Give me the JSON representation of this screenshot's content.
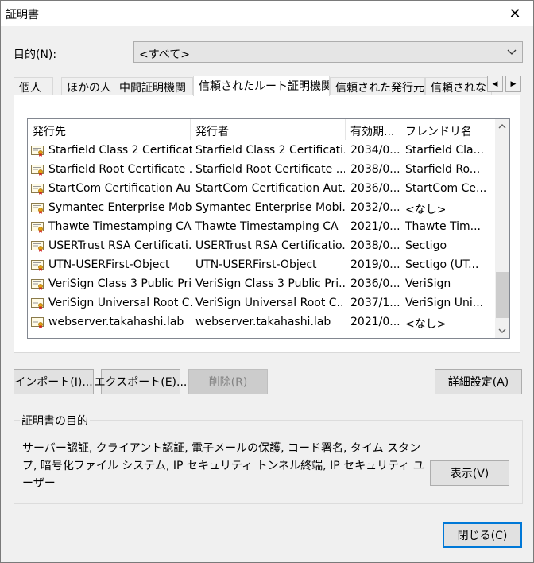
{
  "window": {
    "title": "証明書",
    "close_glyph": "✕"
  },
  "purpose": {
    "label": "目的(N):",
    "selected": "<すべて>"
  },
  "tabs": [
    {
      "label": "個人"
    },
    {
      "label": "ほかの人"
    },
    {
      "label": "中間証明機関"
    },
    {
      "label": "信頼されたルート証明機関",
      "active": true
    },
    {
      "label": "信頼された発行元"
    },
    {
      "label": "信頼されない"
    }
  ],
  "tab_scroll": {
    "left": "◀",
    "right": "▶"
  },
  "list": {
    "columns": [
      "発行先",
      "発行者",
      "有効期...",
      "フレンドリ名"
    ],
    "rows": [
      [
        "Starfield Class 2 Certificat...",
        "Starfield Class 2 Certificati...",
        "2034/0...",
        "Starfield Cla..."
      ],
      [
        "Starfield Root Certificate ...",
        "Starfield Root Certificate ...",
        "2038/0...",
        "Starfield Ro..."
      ],
      [
        "StartCom Certification Au...",
        "StartCom Certification Aut...",
        "2036/0...",
        "StartCom Ce..."
      ],
      [
        "Symantec Enterprise Mob...",
        "Symantec Enterprise Mobi...",
        "2032/0...",
        "<なし>"
      ],
      [
        "Thawte Timestamping CA",
        "Thawte Timestamping CA",
        "2021/0...",
        "Thawte Tim..."
      ],
      [
        "USERTrust RSA Certificati...",
        "USERTrust RSA Certificatio...",
        "2038/0...",
        "Sectigo"
      ],
      [
        "UTN-USERFirst-Object",
        "UTN-USERFirst-Object",
        "2019/0...",
        "Sectigo (UT..."
      ],
      [
        "VeriSign Class 3 Public Pri...",
        "VeriSign Class 3 Public Pri...",
        "2036/0...",
        "VeriSign"
      ],
      [
        "VeriSign Universal Root C...",
        "VeriSign Universal Root C...",
        "2037/1...",
        "VeriSign Uni..."
      ],
      [
        "webserver.takahashi.lab",
        "webserver.takahashi.lab",
        "2021/0...",
        "<なし>"
      ]
    ]
  },
  "buttons": {
    "import": "インポート(I)...",
    "export": "エクスポート(E)...",
    "remove": "削除(R)",
    "advanced": "詳細設定(A)",
    "view": "表示(V)",
    "close": "閉じる(C)"
  },
  "purpose_group": {
    "legend": "証明書の目的",
    "text": "サーバー認証, クライアント認証, 電子メールの保護, コード署名, タイム スタンプ, 暗号化ファイル システム, IP セキュリティ トンネル終端, IP セキュリティ ユーザー"
  }
}
